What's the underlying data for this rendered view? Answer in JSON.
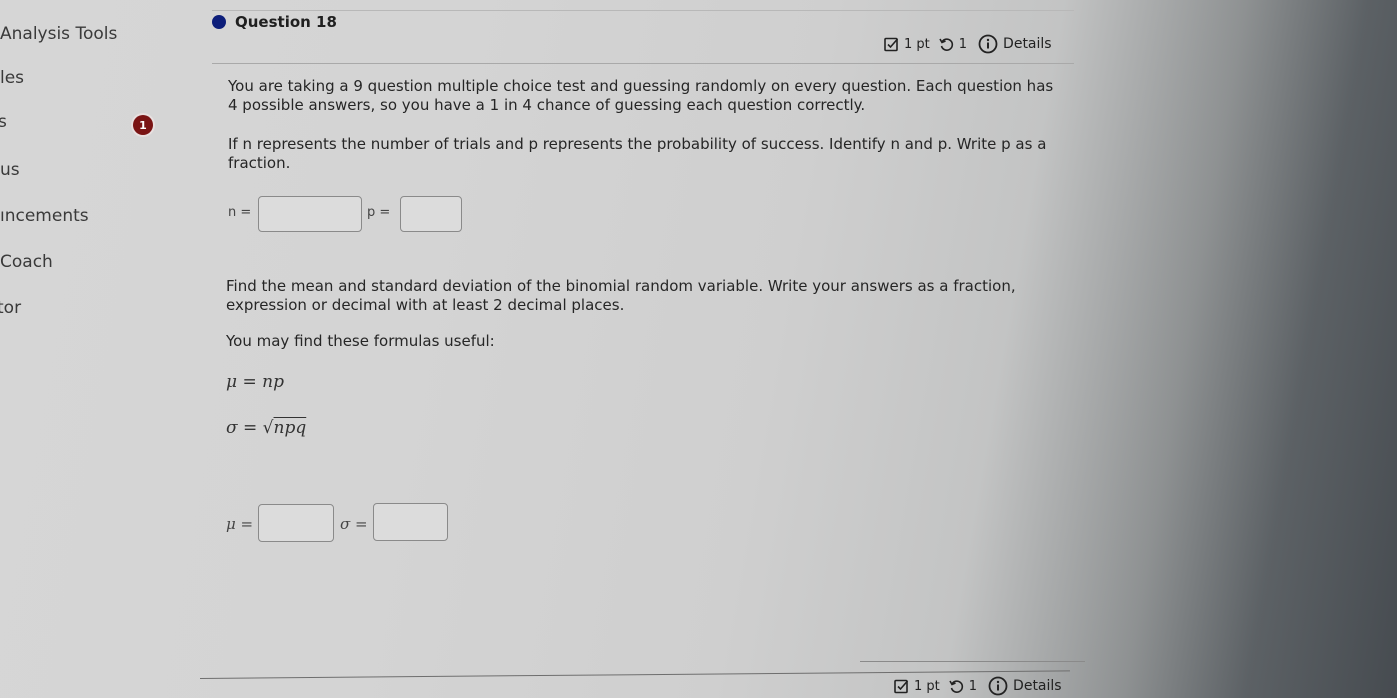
{
  "sidebar": {
    "items": [
      {
        "label": "Analysis Tools"
      },
      {
        "label": "les"
      },
      {
        "label": "s"
      },
      {
        "label": "us"
      },
      {
        "label": "ıncements"
      },
      {
        "label": "Coach"
      },
      {
        "label": "tor"
      }
    ],
    "badge_count": "1",
    "badge_color": "#7a1414"
  },
  "question": {
    "title": "Question 18",
    "dot_color": "#0d1e7a",
    "meta": {
      "points": "1 pt",
      "attempts": "1",
      "details_label": "Details"
    },
    "paragraph_1": "You are taking a 9 question multiple choice test and guessing randomly on every question. Each question has 4 possible answers, so you have a 1 in 4 chance of guessing each question correctly.",
    "paragraph_2": "If n represents the number of trials and p represents the probability of success. Identify n and p. Write p as a fraction.",
    "inputs_1": {
      "n_label": "n =",
      "n_value": "",
      "p_label": "p =",
      "p_value": ""
    },
    "paragraph_3": "Find the mean and standard deviation of the binomial random variable. Write your answers as a fraction, expression or decimal with at least 2 decimal places.",
    "paragraph_4": "You may find these formulas useful:",
    "formula_mu": {
      "lhs": "μ",
      "eq": " = ",
      "rhs": "np"
    },
    "formula_sigma": {
      "lhs": "σ",
      "eq": " = ",
      "root": "√",
      "rhs": "npq"
    },
    "inputs_2": {
      "mu_label": "μ =",
      "mu_value": "",
      "sigma_label": "σ =",
      "sigma_value": ""
    }
  },
  "next_question": {
    "meta": {
      "points": "1 pt",
      "attempts": "1",
      "details_label": "Details"
    }
  }
}
